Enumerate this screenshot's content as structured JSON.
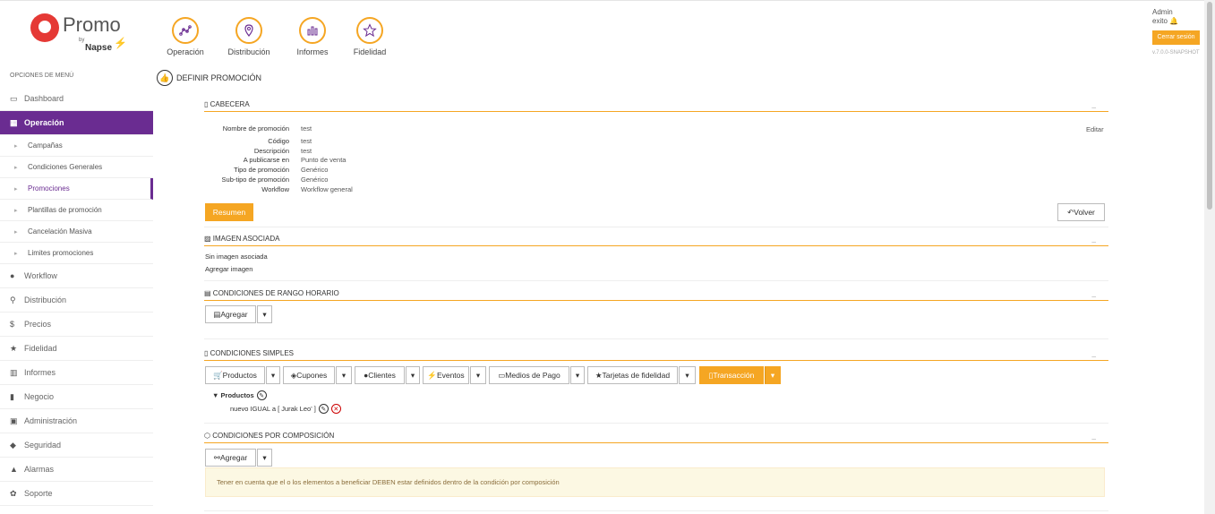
{
  "brand": {
    "name": "Promo",
    "by": "by",
    "company": "Napse"
  },
  "modules": [
    {
      "label": "Operación",
      "icon": "chart-dots-icon"
    },
    {
      "label": "Distribución",
      "icon": "map-pin-icon"
    },
    {
      "label": "Informes",
      "icon": "bar-chart-icon"
    },
    {
      "label": "Fidelidad",
      "icon": "star-icon"
    }
  ],
  "user": {
    "name": "Admin",
    "status": "exito",
    "logout": "Cerrar sesión",
    "version": "v.7.0.0-SNAPSHOT"
  },
  "sidebar": {
    "header": "OPCIONES DE MENÚ",
    "dashboard": "Dashboard",
    "operacion": "Operación",
    "sub": [
      "Campañas",
      "Condiciones Generales",
      "Promociones",
      "Plantillas de promoción",
      "Cancelación Masiva",
      "Limites promociones"
    ],
    "items": [
      "Workflow",
      "Distribución",
      "Precios",
      "Fidelidad",
      "Informes",
      "Negocio",
      "Administración",
      "Seguridad",
      "Alarmas",
      "Soporte"
    ]
  },
  "page": {
    "title": "DEFINIR PROMOCIÓN"
  },
  "cabecera": {
    "title": "CABECERA",
    "edit": "Editar",
    "fields": [
      {
        "label": "Nombre de promoción",
        "value": "test"
      },
      {
        "label": "Código",
        "value": "test"
      },
      {
        "label": "Descripción",
        "value": "test"
      },
      {
        "label": "A publicarse en",
        "value": "Punto de venta"
      },
      {
        "label": "Tipo de promoción",
        "value": "Genérico"
      },
      {
        "label": "Sub-tipo de promoción",
        "value": "Genérico"
      },
      {
        "label": "Workflow",
        "value": "Workflow general"
      }
    ],
    "resumen": "Resumen",
    "volver": "Volver"
  },
  "imagen": {
    "title": "IMAGEN ASOCIADA",
    "none": "Sin imagen asociada",
    "add": "Agregar imagen"
  },
  "rango": {
    "title": "CONDICIONES DE RANGO HORARIO",
    "add": "Agregar"
  },
  "simples": {
    "title": "CONDICIONES SIMPLES",
    "buttons": [
      "Productos",
      "Cupones",
      "Clientes",
      "Eventos",
      "Medios de Pago",
      "Tarjetas de fidelidad",
      "Transacción"
    ],
    "group": "Productos",
    "rule": "nuevo IGUAL a [ Jurak Leo' ]"
  },
  "composicion": {
    "title": "CONDICIONES POR COMPOSICIÓN",
    "add": "Agregar",
    "notice": "Tener en cuenta que el o los elementos a beneficiar DEBEN estar definidos dentro de la condición por composición"
  },
  "colors": {
    "accent": "#f5a623",
    "primary": "#6a2c91"
  }
}
